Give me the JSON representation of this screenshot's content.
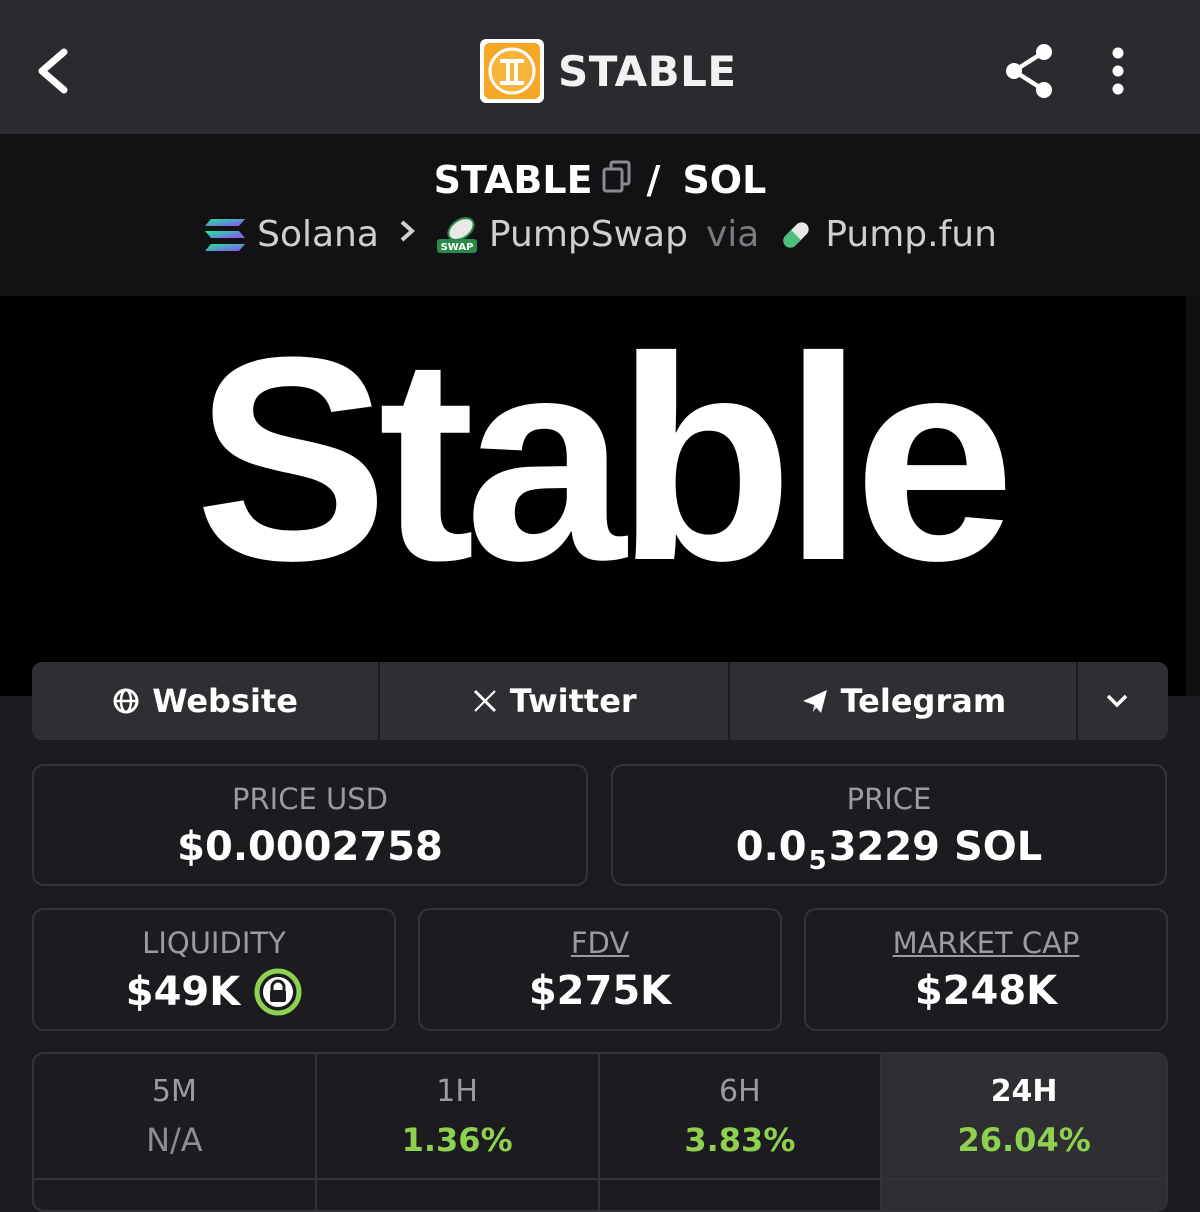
{
  "header": {
    "title": "STABLE",
    "back_icon": "chevron-left-icon",
    "share_icon": "share-icon",
    "menu_icon": "more-vertical-icon",
    "logo_color": "#f6a623"
  },
  "pair": {
    "base": "STABLE",
    "separator": "/",
    "quote": "SOL",
    "chain": "Solana",
    "dex": "PumpSwap",
    "dex_badge": "SWAP",
    "via": "via",
    "launchpad": "Pump.fun"
  },
  "banner": {
    "text": "Stable"
  },
  "links": {
    "website": "Website",
    "twitter": "Twitter",
    "telegram": "Telegram"
  },
  "stats": {
    "price_usd_label": "PRICE USD",
    "price_usd": "$0.0002758",
    "price_label": "PRICE",
    "price_prefix": "0.0",
    "price_zeros": "5",
    "price_rest": "3229 SOL",
    "liquidity_label": "LIQUIDITY",
    "liquidity": "$49K",
    "fdv_label": "FDV",
    "fdv": "$275K",
    "mcap_label": "MARKET CAP",
    "mcap": "$248K"
  },
  "timeframes": [
    {
      "label": "5M",
      "value": "N/A"
    },
    {
      "label": "1H",
      "value": "1.36%"
    },
    {
      "label": "6H",
      "value": "3.83%"
    },
    {
      "label": "24H",
      "value": "26.04%"
    }
  ],
  "colors": {
    "positive": "#8fd14f",
    "lock": "#8fd14f"
  }
}
